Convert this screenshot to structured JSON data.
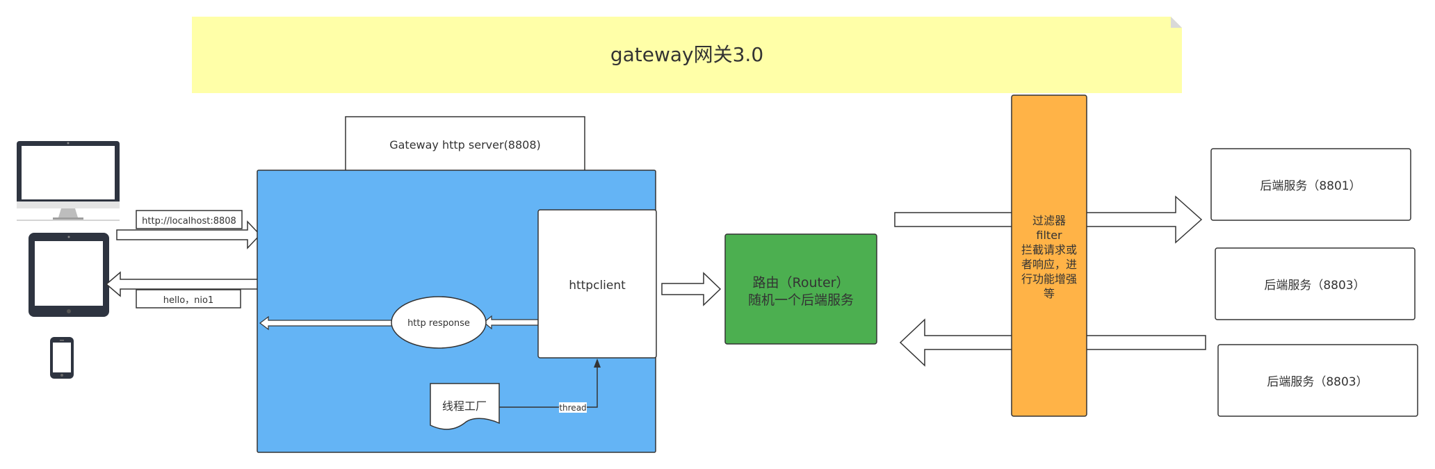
{
  "title": "gateway网关3.0",
  "gateway_server_label": "Gateway http server(8808)",
  "request_url": "http://localhost:8808",
  "response_text": "hello，nio1",
  "http_response": "http response",
  "httpclient": "httpclient",
  "thread_factory": "线程工厂",
  "thread_label": "thread",
  "router": {
    "line1": "路由（Router）",
    "line2": "随机一个后端服务"
  },
  "filter_lines": [
    "过滤器",
    "filter",
    "拦截请求或",
    "者响应，进",
    "行功能增强",
    "等"
  ],
  "backends": [
    "后端服务（8801）",
    "后端服务（8803）",
    "后端服务（8803）"
  ],
  "colors": {
    "note": "#ffffa8",
    "gateway": "#64b4f5",
    "router": "#4caf50",
    "filter": "#ffb347",
    "device": "#2e3440"
  }
}
